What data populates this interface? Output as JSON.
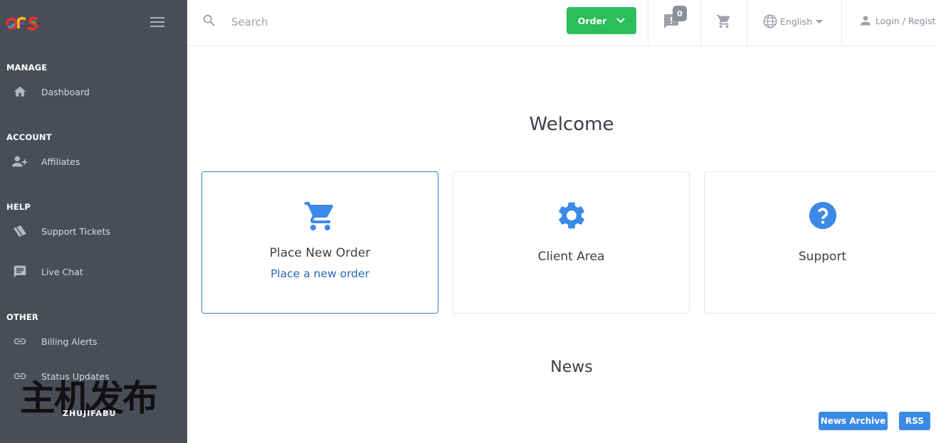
{
  "sidebar": {
    "sections": [
      {
        "title": "MANAGE",
        "items": [
          {
            "label": "Dashboard",
            "icon": "home-icon"
          }
        ]
      },
      {
        "title": "ACCOUNT",
        "items": [
          {
            "label": "Affiliates",
            "icon": "add-user-icon"
          }
        ]
      },
      {
        "title": "HELP",
        "items": [
          {
            "label": "Support Tickets",
            "icon": "ticket-icon"
          },
          {
            "label": "Live Chat",
            "icon": "chat-icon"
          }
        ]
      },
      {
        "title": "OTHER",
        "items": [
          {
            "label": "Billing Alerts",
            "icon": "link-icon"
          },
          {
            "label": "Status Updates",
            "icon": "link-icon"
          }
        ]
      }
    ],
    "watermark": {
      "cn": "主机发布",
      "en": "ZHUJIFABU"
    }
  },
  "header": {
    "search_placeholder": "Search",
    "order_label": "Order",
    "notifications_count": "0",
    "language": "English",
    "login_label": "Login / Register"
  },
  "main": {
    "welcome": "Welcome",
    "cards": [
      {
        "title": "Place New Order",
        "subtitle": "Place a new order",
        "icon": "cart-icon"
      },
      {
        "title": "Client Area",
        "subtitle": "",
        "icon": "gear-icon"
      },
      {
        "title": "Support",
        "subtitle": "",
        "icon": "help-icon"
      }
    ],
    "news_title": "News",
    "news_archive_label": "News Archive",
    "rss_label": "RSS"
  },
  "colors": {
    "sidebar_bg": "#4a4d57",
    "accent_blue": "#3c8ae8",
    "order_green": "#2bbe5b",
    "link_blue": "#2866b5"
  }
}
